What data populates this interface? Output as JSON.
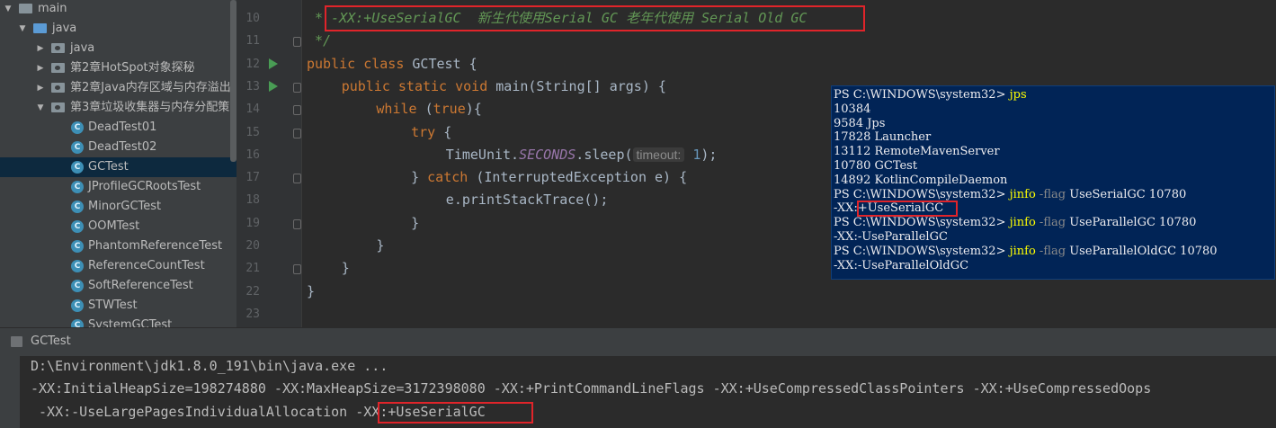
{
  "project_tree": {
    "items": [
      {
        "label": "main",
        "indent": 0,
        "kind": "folder"
      },
      {
        "label": "java",
        "indent": 1,
        "kind": "folder-blue"
      },
      {
        "label": "java",
        "indent": 2,
        "kind": "package"
      },
      {
        "label": "第2章HotSpot对象探秘",
        "indent": 2,
        "kind": "package"
      },
      {
        "label": "第2章Java内存区域与内存溢出",
        "indent": 2,
        "kind": "package"
      },
      {
        "label": "第3章垃圾收集器与内存分配策",
        "indent": 2,
        "kind": "package"
      },
      {
        "label": "DeadTest01",
        "indent": 3,
        "kind": "class"
      },
      {
        "label": "DeadTest02",
        "indent": 3,
        "kind": "class"
      },
      {
        "label": "GCTest",
        "indent": 3,
        "kind": "class",
        "selected": true
      },
      {
        "label": "JProfileGCRootsTest",
        "indent": 3,
        "kind": "class"
      },
      {
        "label": "MinorGCTest",
        "indent": 3,
        "kind": "class"
      },
      {
        "label": "OOMTest",
        "indent": 3,
        "kind": "class"
      },
      {
        "label": "PhantomReferenceTest",
        "indent": 3,
        "kind": "class"
      },
      {
        "label": "ReferenceCountTest",
        "indent": 3,
        "kind": "class"
      },
      {
        "label": "SoftReferenceTest",
        "indent": 3,
        "kind": "class"
      },
      {
        "label": "STWTest",
        "indent": 3,
        "kind": "class"
      },
      {
        "label": "SystemGCTest",
        "indent": 3,
        "kind": "class"
      }
    ]
  },
  "editor": {
    "line_numbers": [
      "10",
      "11",
      "12",
      "13",
      "14",
      "15",
      "16",
      "17",
      "18",
      "19",
      "20",
      "21",
      "22",
      "23"
    ],
    "comment_line": " * -XX:+UseSerialGC  新生代使用Serial GC 老年代使用 Serial Old GC",
    "comment_end": " */",
    "l12_kw1": "public",
    "l12_kw2": "class",
    "l12_name": "GCTest {",
    "l13_kw1": "public",
    "l13_kw2": "static",
    "l13_kw3": "void",
    "l13_rest": "main(String[] args) {",
    "l14_kw": "while",
    "l14_open": " (",
    "l14_true": "true",
    "l14_close": "){",
    "l15_kw": "try",
    "l15_brace": " {",
    "l16_a": "TimeUnit.",
    "l16_b": "SECONDS",
    "l16_c": ".sleep(",
    "l16_hint": "timeout:",
    "l16_num": "1",
    "l16_d": ");",
    "l17_brace": "}",
    "l17_kw": "catch",
    "l17_rest": " (InterruptedException e) {",
    "l18": "e.printStackTrace();",
    "l19": "}",
    "l20": "}",
    "l21": "}",
    "l22": "}"
  },
  "powershell": {
    "lines": [
      {
        "prompt": "PS C:\\WINDOWS\\system32> ",
        "cmd": "jps",
        "flag": "",
        "args": ""
      },
      {
        "text": "10384"
      },
      {
        "text": "9584 Jps"
      },
      {
        "text": "17828 Launcher"
      },
      {
        "text": "13112 RemoteMavenServer"
      },
      {
        "text": "10780 GCTest"
      },
      {
        "text": "14892 KotlinCompileDaemon"
      },
      {
        "prompt": "PS C:\\WINDOWS\\system32> ",
        "cmd": "jinfo",
        "flag": " -flag",
        "args": " UseSerialGC 10780"
      },
      {
        "text": "-XX:+UseSerialGC"
      },
      {
        "prompt": "PS C:\\WINDOWS\\system32> ",
        "cmd": "jinfo",
        "flag": " -flag",
        "args": " UseParallelGC 10780"
      },
      {
        "text": "-XX:-UseParallelGC"
      },
      {
        "prompt": "PS C:\\WINDOWS\\system32> ",
        "cmd": "jinfo",
        "flag": " -flag",
        "args": " UseParallelOldGC 10780"
      },
      {
        "text": "-XX:-UseParallelOldGC"
      }
    ]
  },
  "run_panel": {
    "tab_label": "GCTest",
    "line1": "D:\\Environment\\jdk1.8.0_191\\bin\\java.exe ...",
    "line2": "-XX:InitialHeapSize=198274880 -XX:MaxHeapSize=3172398080 -XX:+PrintCommandLineFlags -XX:+UseCompressedClassPointers -XX:+UseCompressedOops",
    "line3a": " -XX:-UseLargePagesIndividualAllocation ",
    "line3b": "-XX:+UseSerialGC"
  }
}
